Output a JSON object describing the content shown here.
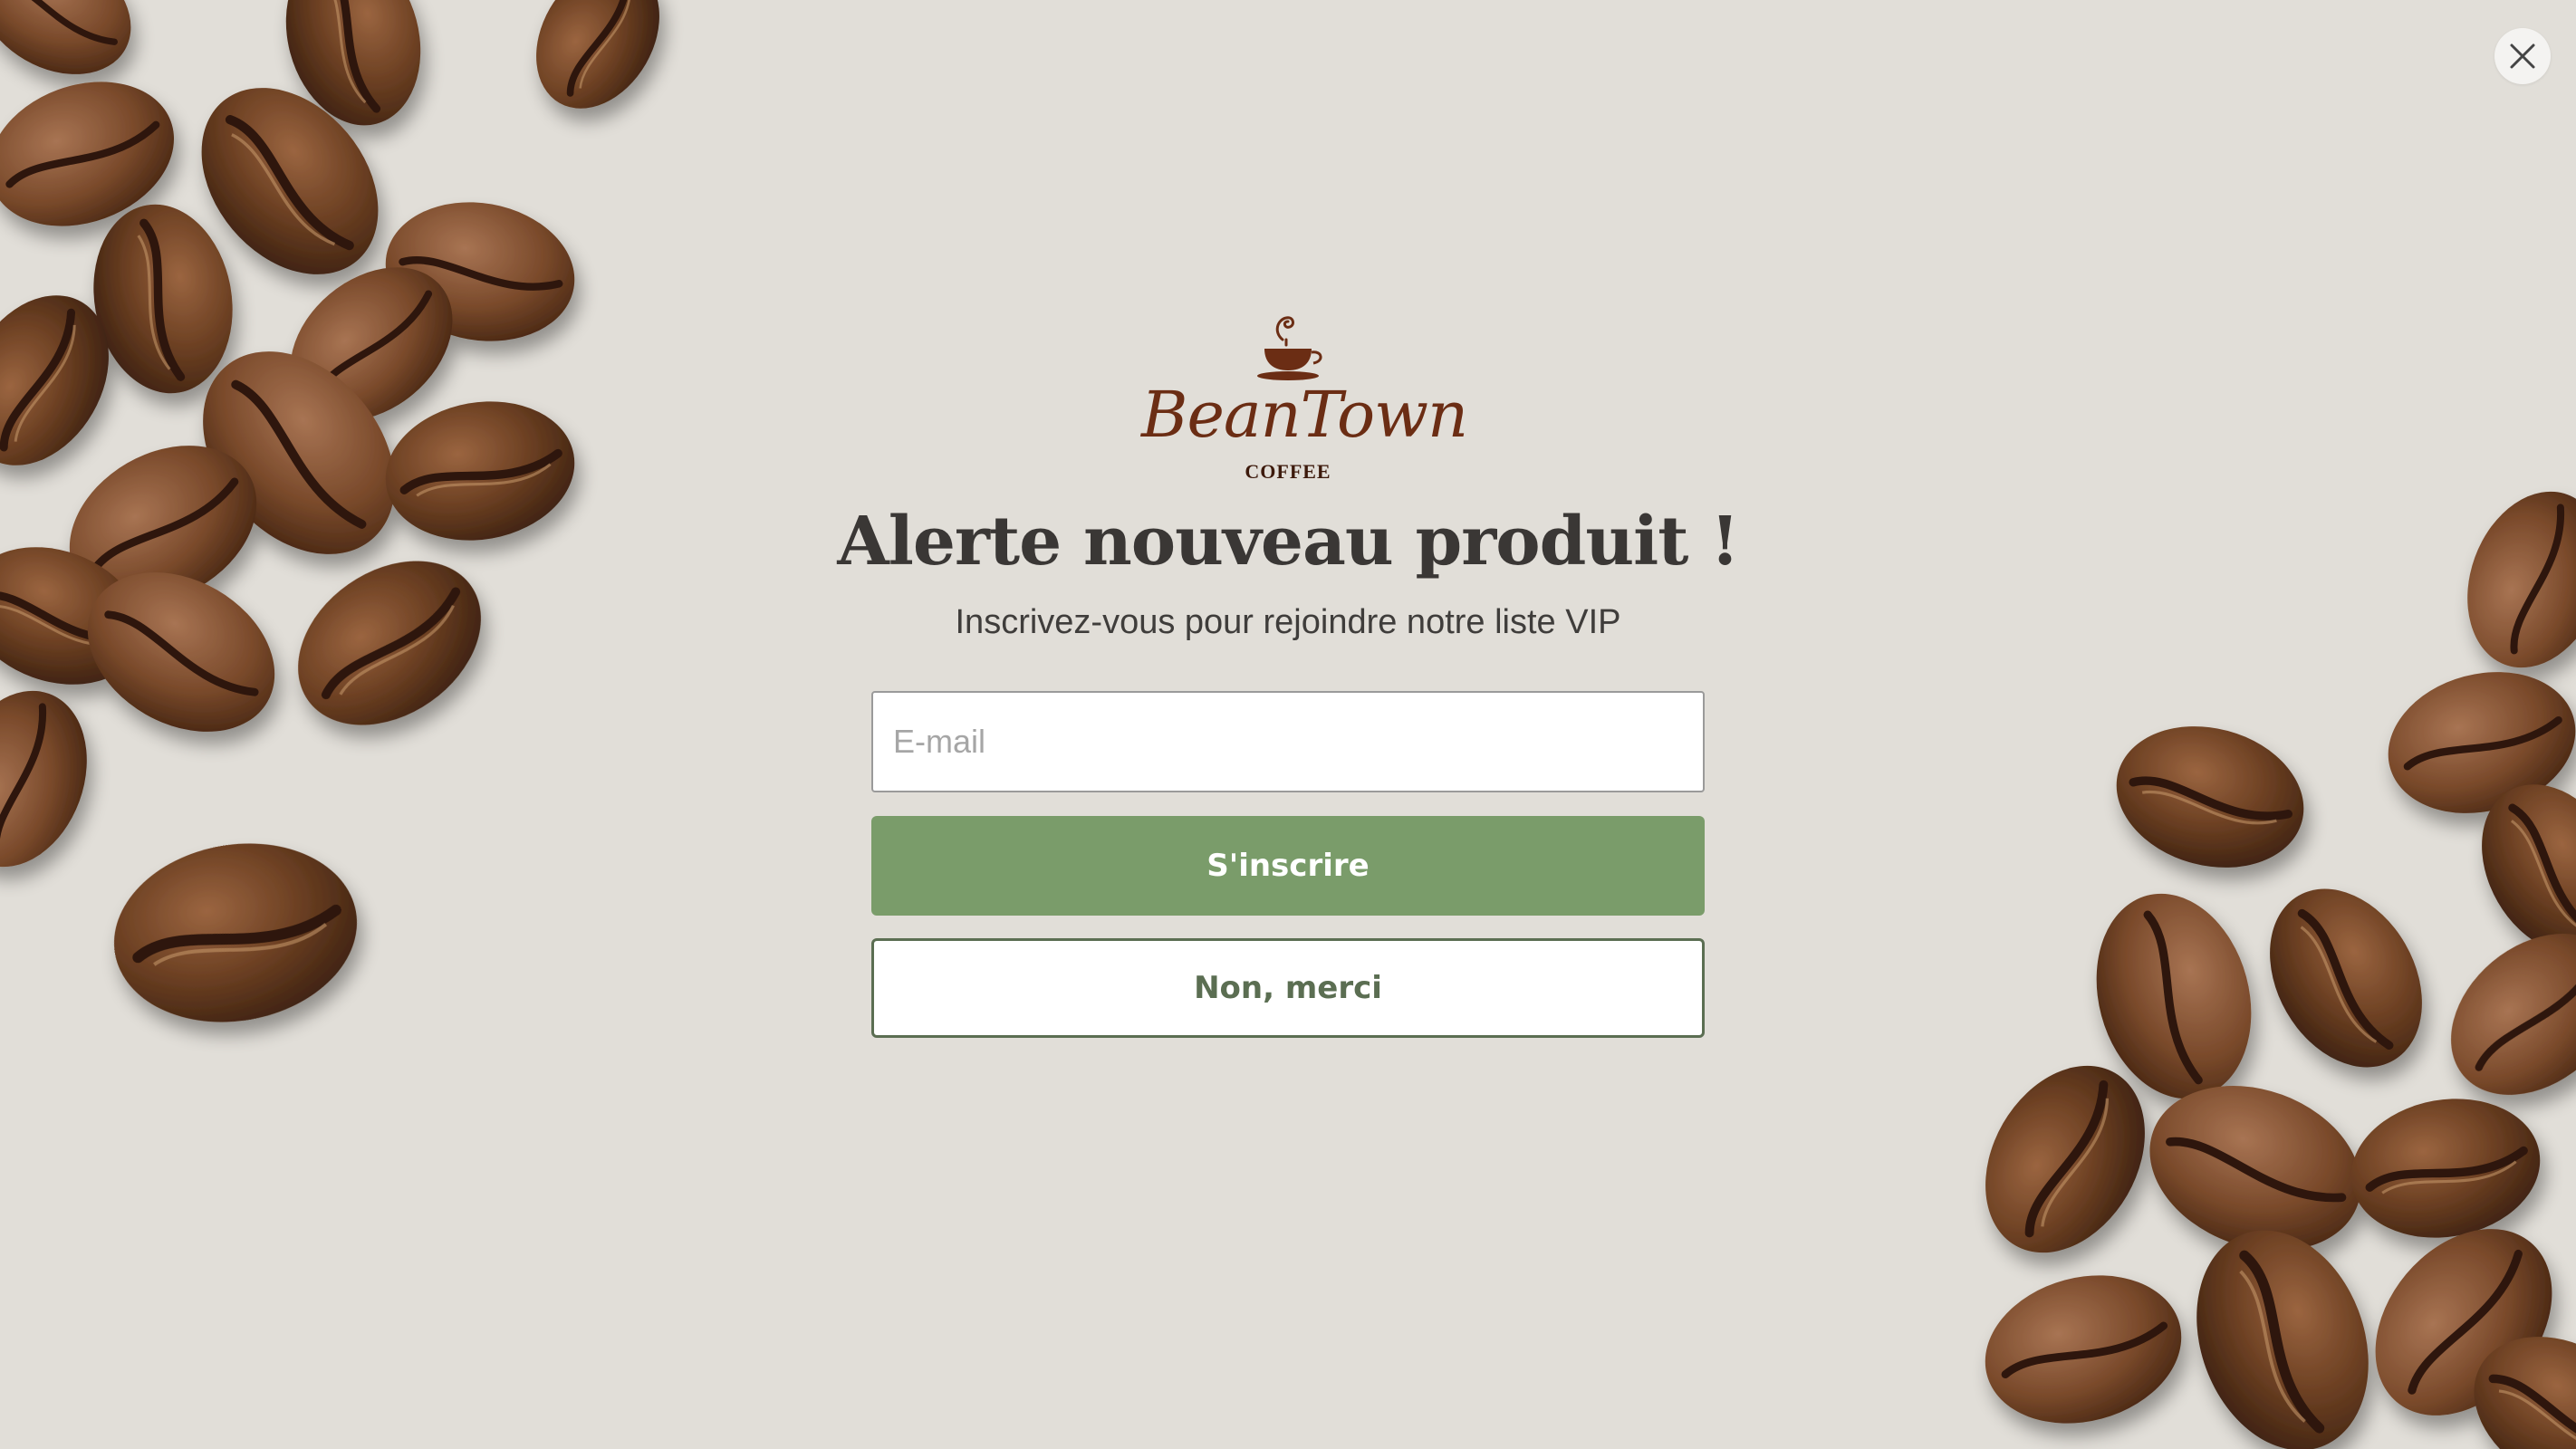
{
  "popup": {
    "logo": {
      "name": "BeanTown",
      "sub": "COFFEE",
      "icon": "coffee-cup-icon"
    },
    "headline": "Alerte nouveau produit !",
    "subheadline": "Inscrivez-vous pour rejoindre notre liste VIP",
    "email_placeholder": "E-mail",
    "email_value": "",
    "subscribe_label": "S'inscrire",
    "decline_label": "Non, merci",
    "close_icon": "close-icon"
  },
  "colors": {
    "background": "#e1ded8",
    "primary_button": "#7a9c6a",
    "secondary_button_text": "#5b6e52",
    "brand": "#6b2d14"
  }
}
